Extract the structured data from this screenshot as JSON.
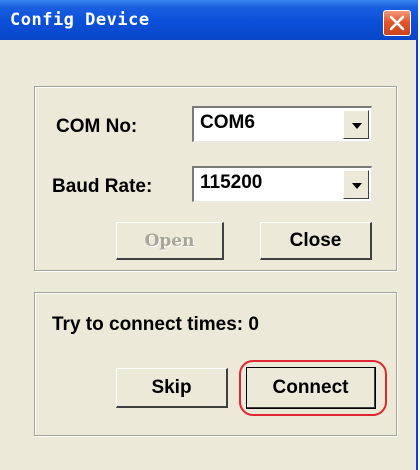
{
  "window": {
    "title": "Config Device"
  },
  "icons": {
    "close": "close-icon",
    "dropdown": "chevron-down-icon"
  },
  "colors": {
    "titlebar": "#0b4fd8",
    "close_button": "#e2572c",
    "window_bg": "#ece9d8",
    "highlight": "#e02630"
  },
  "serial_settings": {
    "com_label": "COM No:",
    "com_value": "COM6",
    "baud_label": "Baud Rate:",
    "baud_value": "115200",
    "open_label": "Open",
    "close_label": "Close"
  },
  "connection": {
    "status_text": "Try to connect times: 0",
    "skip_label": "Skip",
    "connect_label": "Connect"
  }
}
